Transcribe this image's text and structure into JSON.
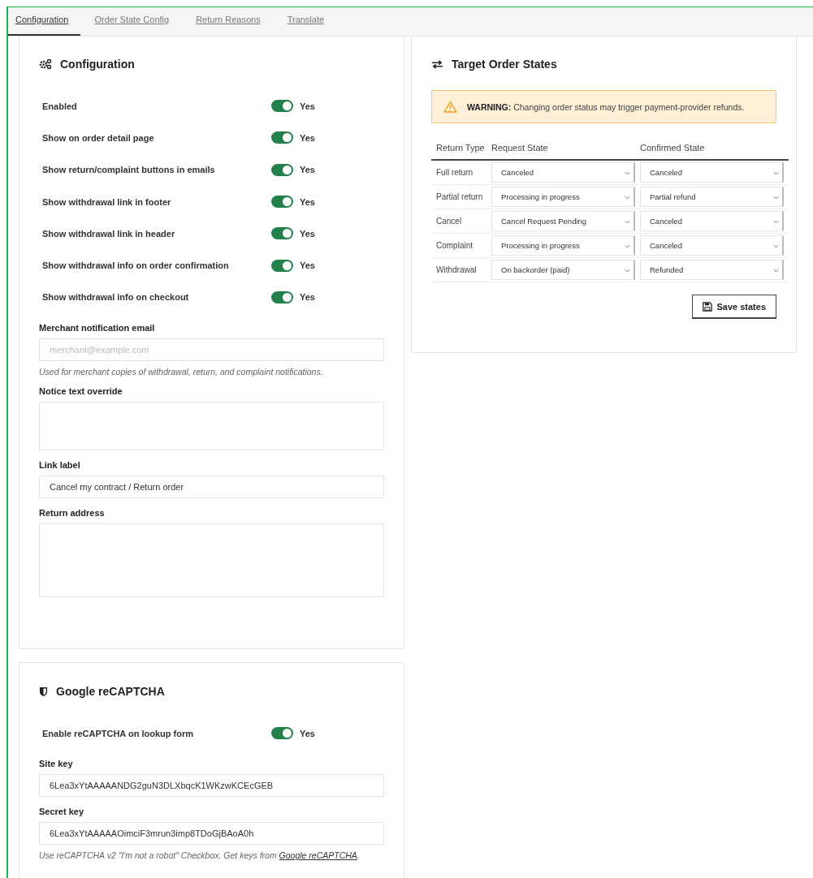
{
  "tabs": [
    {
      "label": "Configuration",
      "selected": true
    },
    {
      "label": "Order State Config",
      "selected": false
    },
    {
      "label": "Return Reasons",
      "selected": false
    },
    {
      "label": "Translate",
      "selected": false
    }
  ],
  "config_panel": {
    "title": "Configuration",
    "toggles": [
      {
        "label": "Enabled",
        "on": true,
        "state_label": "Yes"
      },
      {
        "label": "Show on order detail page",
        "on": true,
        "state_label": "Yes"
      },
      {
        "label": "Show return/complaint buttons in emails",
        "on": true,
        "state_label": "Yes"
      },
      {
        "label": "Show withdrawal link in footer",
        "on": true,
        "state_label": "Yes"
      },
      {
        "label": "Show withdrawal link in header",
        "on": true,
        "state_label": "Yes"
      },
      {
        "label": "Show withdrawal info on order confirmation",
        "on": true,
        "state_label": "Yes"
      },
      {
        "label": "Show withdrawal info on checkout",
        "on": true,
        "state_label": "Yes"
      }
    ],
    "fields": [
      {
        "kind": "input",
        "label": "Merchant notification email",
        "placeholder": "merchant@example.com",
        "help": "Used for merchant copies of withdrawal, return, and complaint notifications."
      },
      {
        "kind": "textarea",
        "label": "Notice text override",
        "tall": false
      },
      {
        "kind": "input",
        "label": "Link label",
        "value": "Cancel my contract / Return order"
      },
      {
        "kind": "textarea",
        "label": "Return address",
        "tall": true
      }
    ]
  },
  "recaptcha_panel": {
    "title": "Google reCAPTCHA",
    "toggles": [
      {
        "label": "Enable reCAPTCHA on lookup form",
        "on": true,
        "state_label": "Yes"
      }
    ],
    "fields": [
      {
        "kind": "input",
        "label": "Site key",
        "value": "6Lea3xYtAAAAANDG2guN3DLXbqcK1WKzwKCEcGEB"
      },
      {
        "kind": "input",
        "label": "Secret key",
        "value": "6Lea3xYtAAAAAOimciF3mrun3imp8TDoGjBAoA0h"
      }
    ],
    "help": {
      "text": "Use reCAPTCHA v2 \"I'm not a robot\" Checkbox. Get keys from ",
      "link": "Google reCAPTCHA",
      "after": "."
    }
  },
  "order_states_panel": {
    "title": "Target Order States",
    "warning": {
      "label": "WARNING:",
      "text": "Changing order status may trigger payment-provider refunds."
    },
    "columns": [
      "Return Type",
      "Request State",
      "Confirmed State"
    ],
    "rows": [
      {
        "type": "Full return",
        "request": "Canceled",
        "confirmed": "Canceled"
      },
      {
        "type": "Partial return",
        "request": "Processing in progress",
        "confirmed": "Partial refund"
      },
      {
        "type": "Cancel",
        "request": "Cancel Request Pending",
        "confirmed": "Canceled"
      },
      {
        "type": "Complaint",
        "request": "Processing in progress",
        "confirmed": "Canceled"
      },
      {
        "type": "Withdrawal",
        "request": "On backorder (paid)",
        "confirmed": "Refunded"
      }
    ],
    "save_button": "Save states"
  }
}
